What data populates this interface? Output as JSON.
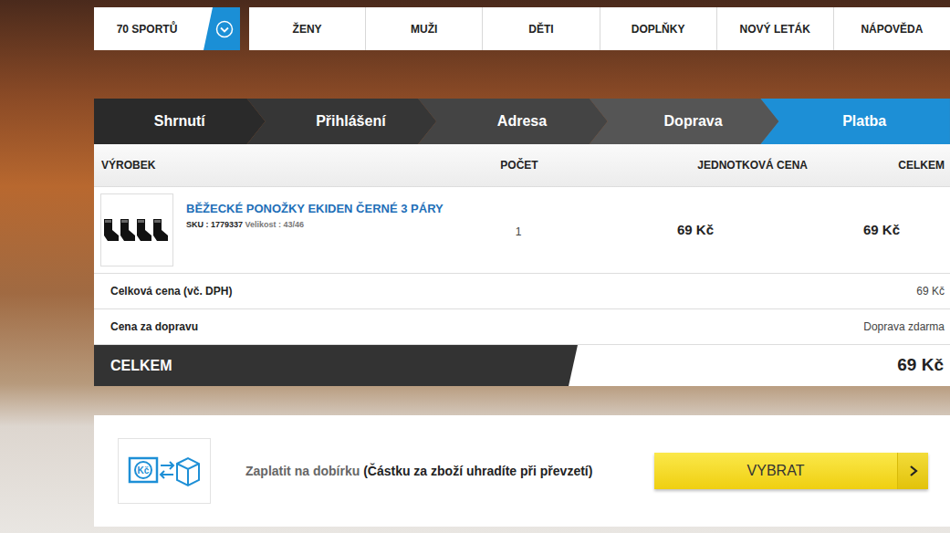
{
  "nav": {
    "sports": "70 SPORTŮ",
    "items": [
      "ŽENY",
      "MUŽI",
      "DĚTI",
      "DOPLŇKY",
      "NOVÝ LETÁK",
      "NÁPOVĚDA"
    ]
  },
  "steps": [
    {
      "label": "Shrnutí",
      "selected": false
    },
    {
      "label": "Přihlášení",
      "selected": false
    },
    {
      "label": "Adresa",
      "selected": false
    },
    {
      "label": "Doprava",
      "selected": false
    },
    {
      "label": "Platba",
      "selected": true
    }
  ],
  "table": {
    "columns": [
      "VÝROBEK",
      "POČET",
      "JEDNOTKOVÁ CENA",
      "CELKEM"
    ],
    "rows": [
      {
        "name": "BĚŽECKÉ PONOŽKY EKIDEN ČERNÉ 3 PÁRY",
        "sku": "SKU : 1779337",
        "size": "Velikost : 43/46",
        "quantity": "1",
        "unit_price": "69 Kč",
        "total": "69 Kč"
      }
    ]
  },
  "summary": [
    {
      "label": "Celková cena (vč. DPH)",
      "value": "69 Kč"
    },
    {
      "label": "Cena za dopravu",
      "value": "Doprava zdarma"
    }
  ],
  "grand_total": {
    "label": "CELKEM",
    "value": "69 Kč"
  },
  "payment": [
    {
      "icon_text": "Kč",
      "title": "Zaplatit na dobírku",
      "note": "(Částku za zboží uhradíte při převzetí)",
      "button": "VYBRAT"
    }
  ]
}
